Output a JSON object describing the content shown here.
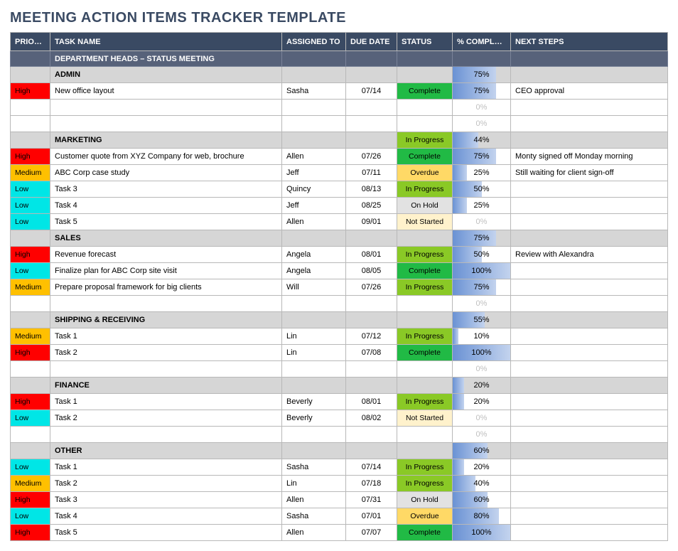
{
  "title": "MEETING ACTION ITEMS TRACKER TEMPLATE",
  "columns": [
    "PRIORITY",
    "TASK NAME",
    "ASSIGNED TO",
    "DUE DATE",
    "STATUS",
    "% COMPLETE",
    "NEXT STEPS"
  ],
  "section_title": "DEPARTMENT HEADS – STATUS MEETING",
  "rows": [
    {
      "type": "group",
      "task": "ADMIN",
      "pct": 75
    },
    {
      "type": "item",
      "priority": "High",
      "task": "New office layout",
      "assigned": "Sasha",
      "due": "07/14",
      "status": "Complete",
      "pct": 75,
      "next": "CEO approval"
    },
    {
      "type": "blank",
      "pct": 0
    },
    {
      "type": "blank",
      "pct": 0
    },
    {
      "type": "group",
      "task": "MARKETING",
      "status": "In Progress",
      "pct": 44
    },
    {
      "type": "item",
      "priority": "High",
      "task": "Customer quote from XYZ Company for web, brochure",
      "assigned": "Allen",
      "due": "07/26",
      "status": "Complete",
      "pct": 75,
      "next": "Monty signed off Monday morning"
    },
    {
      "type": "item",
      "priority": "Medium",
      "task": "ABC Corp case study",
      "assigned": "Jeff",
      "due": "07/11",
      "status": "Overdue",
      "pct": 25,
      "next": "Still waiting for client sign-off"
    },
    {
      "type": "item",
      "priority": "Low",
      "task": "Task 3",
      "assigned": "Quincy",
      "due": "08/13",
      "status": "In Progress",
      "pct": 50,
      "next": ""
    },
    {
      "type": "item",
      "priority": "Low",
      "task": "Task 4",
      "assigned": "Jeff",
      "due": "08/25",
      "status": "On Hold",
      "pct": 25,
      "next": ""
    },
    {
      "type": "item",
      "priority": "Low",
      "task": "Task 5",
      "assigned": "Allen",
      "due": "09/01",
      "status": "Not Started",
      "pct": 0,
      "next": ""
    },
    {
      "type": "group",
      "task": "SALES",
      "pct": 75
    },
    {
      "type": "item",
      "priority": "High",
      "task": "Revenue forecast",
      "assigned": "Angela",
      "due": "08/01",
      "status": "In Progress",
      "pct": 50,
      "next": "Review with Alexandra"
    },
    {
      "type": "item",
      "priority": "Low",
      "task": "Finalize plan for ABC Corp site visit",
      "assigned": "Angela",
      "due": "08/05",
      "status": "Complete",
      "pct": 100,
      "next": ""
    },
    {
      "type": "item",
      "priority": "Medium",
      "task": "Prepare proposal framework for big clients",
      "assigned": "Will",
      "due": "07/26",
      "status": "In Progress",
      "pct": 75,
      "next": ""
    },
    {
      "type": "blank",
      "pct": 0
    },
    {
      "type": "group",
      "task": "SHIPPING & RECEIVING",
      "pct": 55
    },
    {
      "type": "item",
      "priority": "Medium",
      "task": "Task 1",
      "assigned": "Lin",
      "due": "07/12",
      "status": "In Progress",
      "pct": 10,
      "next": ""
    },
    {
      "type": "item",
      "priority": "High",
      "task": "Task 2",
      "assigned": "Lin",
      "due": "07/08",
      "status": "Complete",
      "pct": 100,
      "next": ""
    },
    {
      "type": "blank",
      "pct": 0
    },
    {
      "type": "group",
      "task": "FINANCE",
      "pct": 20
    },
    {
      "type": "item",
      "priority": "High",
      "task": "Task 1",
      "assigned": "Beverly",
      "due": "08/01",
      "status": "In Progress",
      "pct": 20,
      "next": ""
    },
    {
      "type": "item",
      "priority": "Low",
      "task": "Task 2",
      "assigned": "Beverly",
      "due": "08/02",
      "status": "Not Started",
      "pct": 0,
      "next": ""
    },
    {
      "type": "blank",
      "pct": 0
    },
    {
      "type": "group",
      "task": "OTHER",
      "pct": 60
    },
    {
      "type": "item",
      "priority": "Low",
      "task": "Task 1",
      "assigned": "Sasha",
      "due": "07/14",
      "status": "In Progress",
      "pct": 20,
      "next": ""
    },
    {
      "type": "item",
      "priority": "Medium",
      "task": "Task 2",
      "assigned": "Lin",
      "due": "07/18",
      "status": "In Progress",
      "pct": 40,
      "next": ""
    },
    {
      "type": "item",
      "priority": "High",
      "task": "Task 3",
      "assigned": "Allen",
      "due": "07/31",
      "status": "On Hold",
      "pct": 60,
      "next": ""
    },
    {
      "type": "item",
      "priority": "Low",
      "task": "Task 4",
      "assigned": "Sasha",
      "due": "07/01",
      "status": "Overdue",
      "pct": 80,
      "next": ""
    },
    {
      "type": "item",
      "priority": "High",
      "task": "Task 5",
      "assigned": "Allen",
      "due": "07/07",
      "status": "Complete",
      "pct": 100,
      "next": ""
    }
  ]
}
